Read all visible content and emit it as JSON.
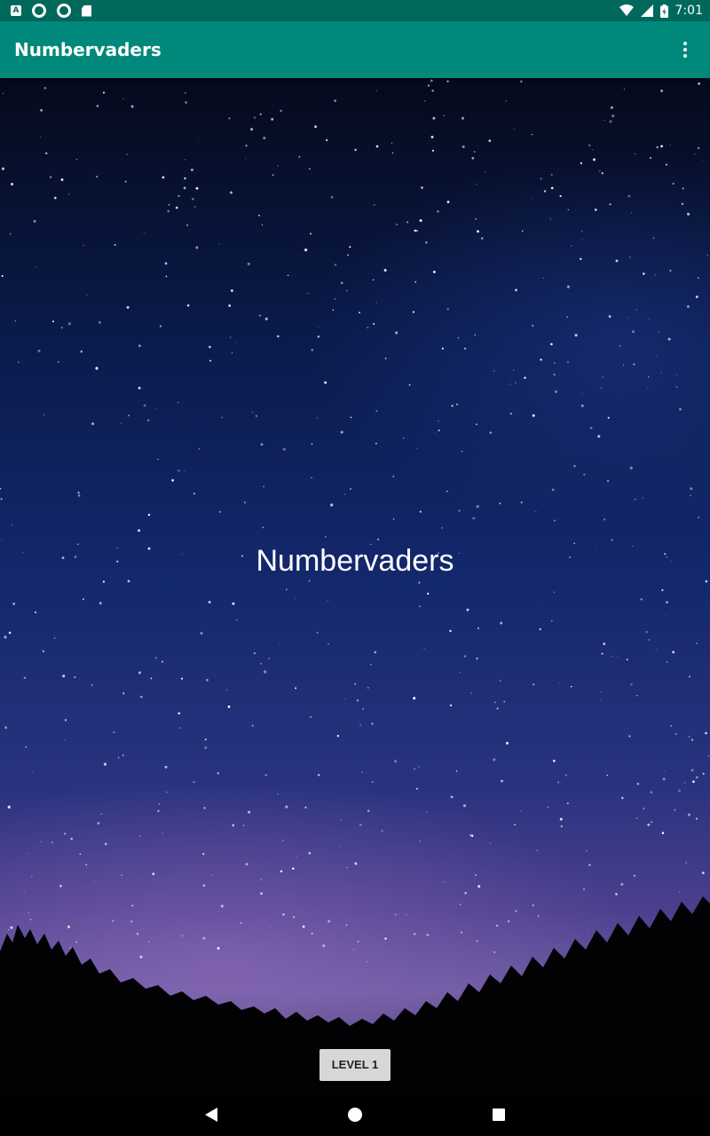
{
  "status_bar": {
    "time": "7:01",
    "left_icons": [
      "a-notification-icon",
      "circle-notification-icon",
      "circle-notification-icon",
      "sd-card-icon"
    ],
    "right_icons": [
      "wifi-icon",
      "signal-icon",
      "battery-icon"
    ]
  },
  "app_bar": {
    "title": "Numbervaders",
    "menu_icon": "more-vertical-icon",
    "color": "#00897b"
  },
  "main": {
    "title": "Numbervaders",
    "level_button_label": "LEVEL 1",
    "background": "night-sky-starfield-with-treeline"
  },
  "nav_bar": {
    "icons": [
      "back-icon",
      "home-icon",
      "recents-icon"
    ]
  }
}
